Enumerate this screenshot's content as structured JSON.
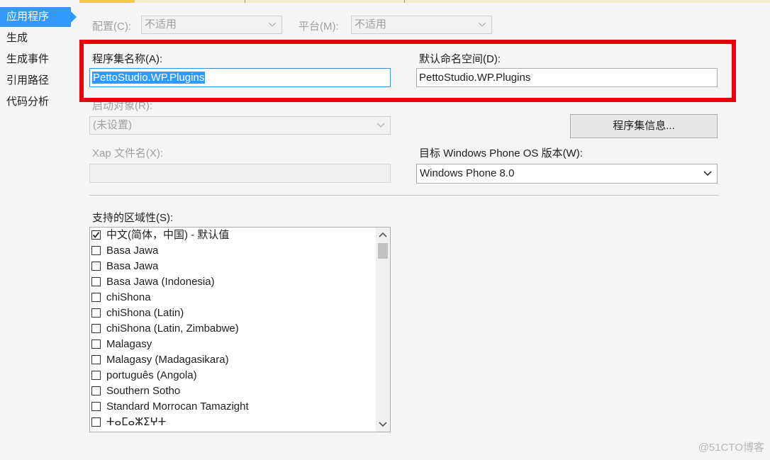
{
  "nav": {
    "items": [
      {
        "label": "应用程序"
      },
      {
        "label": "生成"
      },
      {
        "label": "生成事件"
      },
      {
        "label": "引用路径"
      },
      {
        "label": "代码分析"
      }
    ]
  },
  "config": {
    "configuration_label": "配置(C):",
    "configuration_value": "不适用",
    "platform_label": "平台(M):",
    "platform_value": "不适用"
  },
  "assembly": {
    "name_label": "程序集名称(A):",
    "name_value": "PettoStudio.WP.Plugins",
    "namespace_label": "默认命名空间(D):",
    "namespace_value": "PettoStudio.WP.Plugins",
    "startup_label": "启动对象(R):",
    "startup_value": "(未设置)",
    "info_button": "程序集信息...",
    "xap_label": "Xap 文件名(X):",
    "xap_value": "",
    "target_label": "目标 Windows Phone OS 版本(W):",
    "target_value": "Windows Phone 8.0"
  },
  "cultures": {
    "label": "支持的区域性(S):",
    "items": [
      {
        "label": "中文(简体，中国) - 默认值",
        "checked": true
      },
      {
        "label": "Basa Jawa",
        "checked": false
      },
      {
        "label": "Basa Jawa",
        "checked": false
      },
      {
        "label": "Basa Jawa (Indonesia)",
        "checked": false
      },
      {
        "label": "chiShona",
        "checked": false
      },
      {
        "label": "chiShona (Latin)",
        "checked": false
      },
      {
        "label": "chiShona (Latin, Zimbabwe)",
        "checked": false
      },
      {
        "label": "Malagasy",
        "checked": false
      },
      {
        "label": "Malagasy (Madagasikara)",
        "checked": false
      },
      {
        "label": "português (Angola)",
        "checked": false
      },
      {
        "label": "Southern Sotho",
        "checked": false
      },
      {
        "label": "Standard Morrocan Tamazight",
        "checked": false
      },
      {
        "label": "ⵜⴰⵎⴰⵣⵉⵖⵜ",
        "checked": false
      }
    ]
  },
  "watermark": "@51CTO博客",
  "colors": {
    "accent": "#3399ff",
    "highlight": "#e8000b"
  },
  "icons": [
    "chevron-down-icon",
    "chevron-up-icon",
    "check-icon"
  ]
}
